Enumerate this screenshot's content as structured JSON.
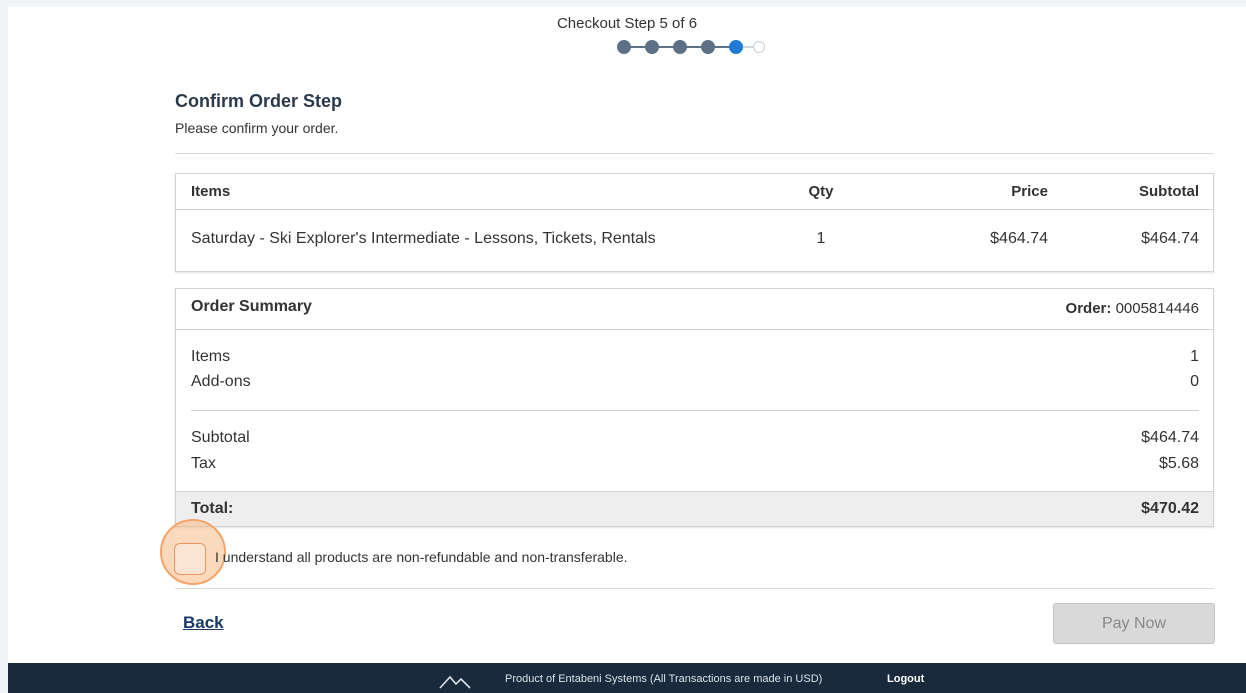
{
  "stepper": {
    "label": "Checkout Step 5 of 6",
    "current_step": 5,
    "total_steps": 6
  },
  "header": {
    "title": "Confirm Order Step",
    "subtitle": "Please confirm your order."
  },
  "items_table": {
    "columns": {
      "name": "Items",
      "qty": "Qty",
      "price": "Price",
      "subtotal": "Subtotal"
    },
    "rows": [
      {
        "name": "Saturday - Ski Explorer's Intermediate - Lessons, Tickets, Rentals",
        "qty": "1",
        "price": "$464.74",
        "subtotal": "$464.74"
      }
    ]
  },
  "summary": {
    "title": "Order Summary",
    "order_label": "Order:",
    "order_number": "0005814446",
    "items_label": "Items",
    "items_value": "1",
    "addons_label": "Add-ons",
    "addons_value": "0",
    "subtotal_label": "Subtotal",
    "subtotal_value": "$464.74",
    "tax_label": "Tax",
    "tax_value": "$5.68",
    "total_label": "Total:",
    "total_value": "$470.42"
  },
  "agreement": {
    "text": "I understand all products are non-refundable and non-transferable.",
    "checked": false
  },
  "actions": {
    "back_label": "Back",
    "pay_label": "Pay Now"
  },
  "footer": {
    "text": "Product of Entabeni Systems (All Transactions are made in USD)",
    "logout_label": "Logout"
  },
  "colors": {
    "accent": "#1f7ad6",
    "footer_bg": "#182a3c",
    "step_done": "#5d7186"
  }
}
